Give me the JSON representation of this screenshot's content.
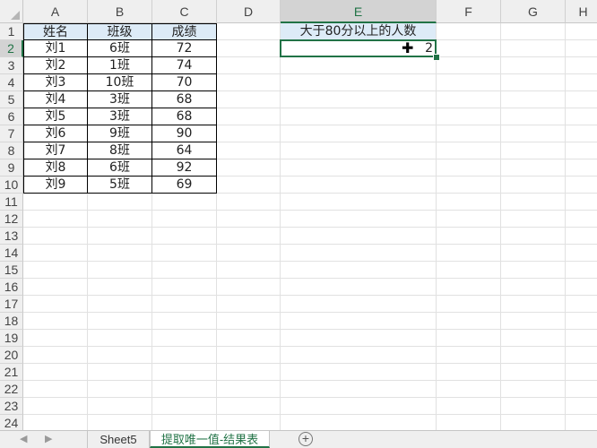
{
  "columns": [
    "A",
    "B",
    "C",
    "D",
    "E",
    "F",
    "G",
    "H"
  ],
  "rows": [
    "1",
    "2",
    "3",
    "4",
    "5",
    "6",
    "7",
    "8",
    "9",
    "10",
    "11",
    "12",
    "13",
    "14",
    "15",
    "16",
    "17",
    "18",
    "19",
    "20",
    "21",
    "22",
    "23",
    "24"
  ],
  "table": {
    "headers": [
      "姓名",
      "班级",
      "成绩"
    ],
    "data": [
      [
        "刘1",
        "6班",
        "72"
      ],
      [
        "刘2",
        "1班",
        "74"
      ],
      [
        "刘3",
        "10班",
        "70"
      ],
      [
        "刘4",
        "3班",
        "68"
      ],
      [
        "刘5",
        "3班",
        "68"
      ],
      [
        "刘6",
        "9班",
        "90"
      ],
      [
        "刘7",
        "8班",
        "64"
      ],
      [
        "刘8",
        "6班",
        "92"
      ],
      [
        "刘9",
        "5班",
        "69"
      ]
    ]
  },
  "summary": {
    "label": "大于80分以上的人数",
    "value": "2"
  },
  "selected_cell": "E2",
  "sheet_tabs": [
    {
      "label": "Sheet5",
      "active": false
    },
    {
      "label": "提取唯一值-结果表",
      "active": true
    }
  ],
  "add_sheet_glyph": "+",
  "icons": {
    "cursor": "fat-cross-cursor-icon",
    "nav_prev": "tab-prev-icon",
    "nav_next": "tab-next-icon"
  },
  "colors": {
    "accent": "#217346",
    "header_fill": "#ddebf7"
  }
}
